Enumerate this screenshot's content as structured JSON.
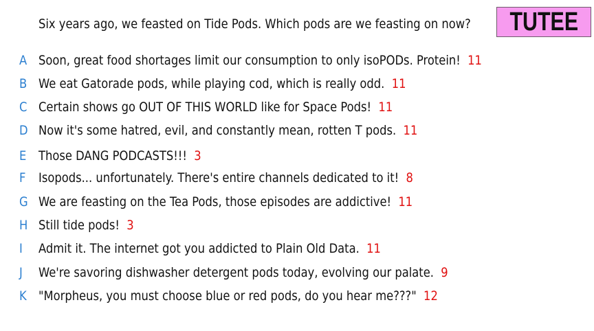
{
  "badge": {
    "label": "TUTEE",
    "background": "#f79bef"
  },
  "question": "Six years ago, we feasted on Tide Pods. Which pods are we feasting on now?",
  "colors": {
    "letter": "#2b7fd0",
    "count": "#e01010",
    "text": "#111111"
  },
  "options": [
    {
      "letter": "A",
      "text": "Soon, great food shortages limit our consumption to only isoPODs. Protein!",
      "count": "11"
    },
    {
      "letter": "B",
      "text": "We eat Gatorade pods, while playing cod, which is really odd.",
      "count": "11"
    },
    {
      "letter": "C",
      "text": "Certain shows go OUT OF THIS WORLD like for Space Pods!",
      "count": "11"
    },
    {
      "letter": "D",
      "text": "Now it's some hatred, evil, and constantly mean, rotten T pods.",
      "count": "11"
    },
    {
      "letter": "E",
      "text": "Those DANG PODCASTS!!!",
      "count": "3"
    },
    {
      "letter": "F",
      "text": "Isopods... unfortunately.  There's entire channels dedicated to it!",
      "count": "8"
    },
    {
      "letter": "G",
      "text": "We are feasting on the Tea Pods, those episodes are addictive!",
      "count": "11"
    },
    {
      "letter": "H",
      "text": "Still tide pods!",
      "count": "3"
    },
    {
      "letter": "I",
      "text": "Admit it. The internet got you addicted to Plain Old Data.",
      "count": "11"
    },
    {
      "letter": "J",
      "text": "We're savoring dishwasher detergent pods today, evolving our palate.",
      "count": "9"
    },
    {
      "letter": "K",
      "text": "\"Morpheus, you must choose blue or red pods, do you hear me???\"",
      "count": "12"
    }
  ]
}
